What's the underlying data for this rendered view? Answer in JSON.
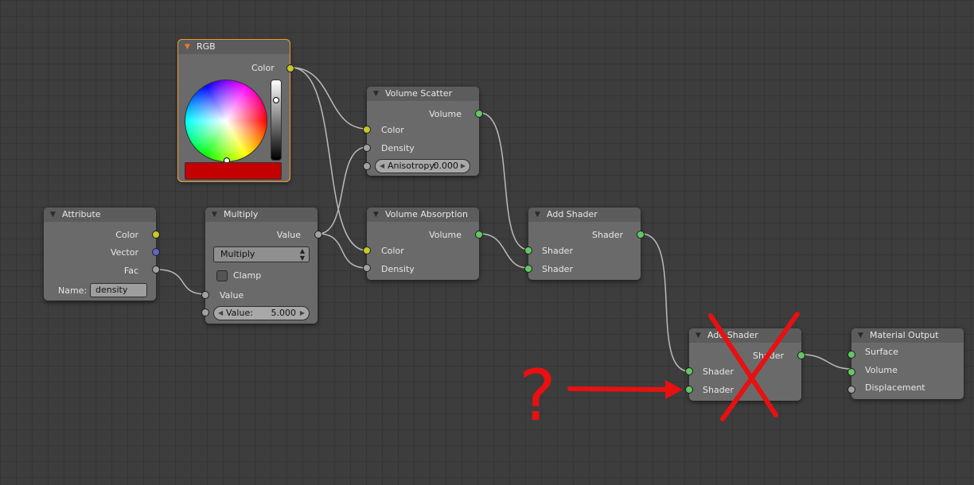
{
  "colors": {
    "background": "#3d3d3d",
    "socket_color": "#c7c729",
    "socket_value": "#a1a1a1",
    "socket_shader": "#63c763",
    "socket_vector": "#6363c7",
    "active_outline": "#f09a33",
    "annotation_red": "#e81010",
    "rgb_swatch": "#c40000"
  },
  "nodes": {
    "rgb": {
      "title": "RGB",
      "output_color": "Color"
    },
    "attribute": {
      "title": "Attribute",
      "outputs": [
        "Color",
        "Vector",
        "Fac"
      ],
      "name_label": "Name:",
      "name_value": "density"
    },
    "multiply": {
      "title": "Multiply",
      "output_value": "Value",
      "operation": "Multiply",
      "clamp_label": "Clamp",
      "input_value_label": "Value",
      "value_field_label": "Value:",
      "value_field_value": "5.000"
    },
    "volume_scatter": {
      "title": "Volume Scatter",
      "output_volume": "Volume",
      "input_color": "Color",
      "input_density": "Density",
      "anisotropy_label": "Anisotropy:",
      "anisotropy_value": "0.000"
    },
    "volume_absorption": {
      "title": "Volume Absorption",
      "output_volume": "Volume",
      "input_color": "Color",
      "input_density": "Density"
    },
    "add_shader_1": {
      "title": "Add Shader",
      "output_shader": "Shader",
      "inputs": [
        "Shader",
        "Shader"
      ]
    },
    "add_shader_2": {
      "title": "Add Shader",
      "output_shader": "Shader",
      "inputs": [
        "Shader",
        "Shader"
      ]
    },
    "material_output": {
      "title": "Material Output",
      "inputs": [
        "Surface",
        "Volume",
        "Displacement"
      ]
    }
  },
  "annotation": {
    "question_mark": "?"
  }
}
